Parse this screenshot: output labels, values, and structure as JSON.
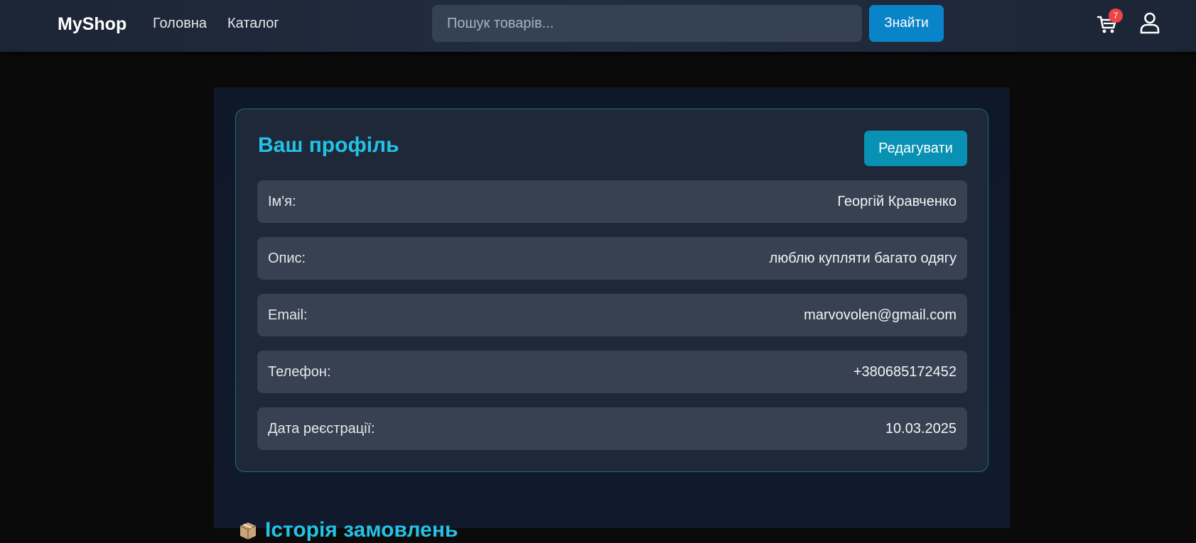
{
  "header": {
    "logo": "MyShop",
    "nav": [
      {
        "label": "Головна"
      },
      {
        "label": "Каталог"
      }
    ],
    "search": {
      "placeholder": "Пошук товарів...",
      "value": "",
      "button_label": "Знайти"
    },
    "cart": {
      "icon": "cart-icon",
      "count": "7"
    },
    "user": {
      "icon": "user-icon"
    }
  },
  "profile": {
    "title": "Ваш профіль",
    "edit_label": "Редагувати",
    "fields": [
      {
        "label": "Ім'я:",
        "value": "Георгій Кравченко"
      },
      {
        "label": "Опис:",
        "value": "люблю купляти багато одягу"
      },
      {
        "label": "Email:",
        "value": "marvovolen@gmail.com"
      },
      {
        "label": "Телефон:",
        "value": "+380685172452"
      },
      {
        "label": "Дата реєстрації:",
        "value": "10.03.2025"
      }
    ]
  },
  "orders": {
    "icon": "box-icon",
    "title": "Історія замовлень"
  },
  "colors": {
    "accent": "#22c3e6",
    "primary_button": "#0a84c8",
    "edit_button": "#0891b2",
    "badge": "#ef4444",
    "row_bg": "#374151",
    "card_bg": "#1e2838"
  }
}
